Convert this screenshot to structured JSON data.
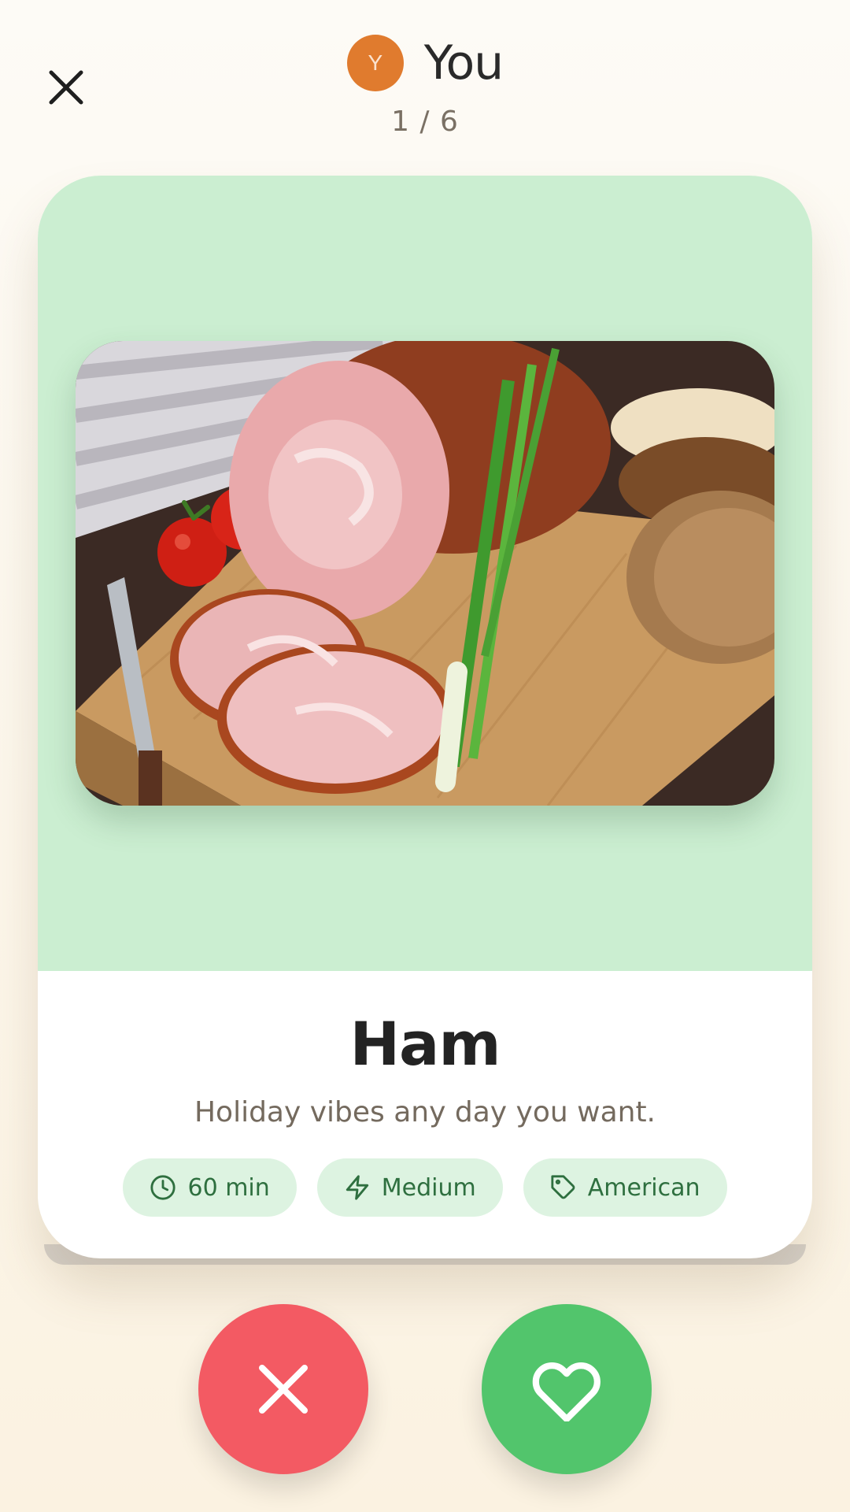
{
  "header": {
    "avatar_initial": "Y",
    "user_name": "You",
    "counter": "1 / 6"
  },
  "recipe": {
    "title": "Ham",
    "description": "Holiday vibes any day you want.",
    "tags": [
      {
        "icon": "clock-icon",
        "label": "60 min"
      },
      {
        "icon": "lightning-icon",
        "label": "Medium"
      },
      {
        "icon": "tag-icon",
        "label": "American"
      }
    ]
  },
  "colors": {
    "avatar": "#e07b2e",
    "card_top": "#cbeed1",
    "dislike": "#f35a63",
    "like": "#52c56c",
    "tag_bg": "#ddf3e1",
    "tag_text": "#2e6f3f"
  },
  "icons": {
    "close": "close-icon",
    "dislike": "x-icon",
    "like": "heart-icon"
  }
}
